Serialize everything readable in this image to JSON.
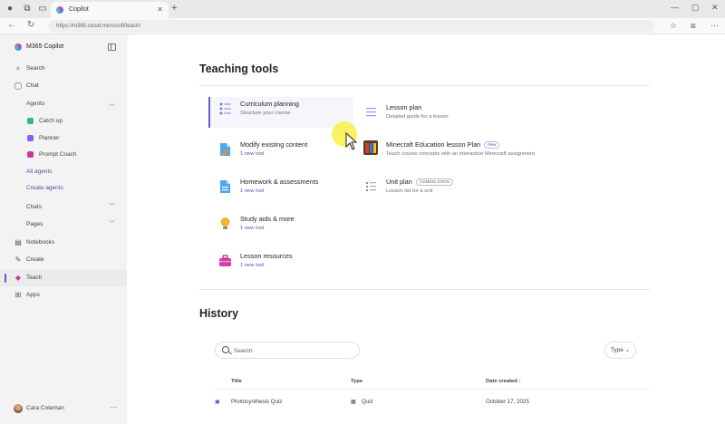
{
  "browser": {
    "tab_title": "Copilot",
    "url": "https://m365.cloud.microsoft/teach/"
  },
  "sidebar": {
    "brand": "M365 Copilot",
    "items": [
      {
        "label": "Search"
      },
      {
        "label": "Chat"
      },
      {
        "label": "Agents"
      },
      {
        "label": "Catch up"
      },
      {
        "label": "Planner"
      },
      {
        "label": "Prompt Coach"
      },
      {
        "label": "All agents"
      },
      {
        "label": "Create agents"
      },
      {
        "label": "Chats"
      },
      {
        "label": "Pages"
      },
      {
        "label": "Notebooks"
      },
      {
        "label": "Create"
      },
      {
        "label": "Teach"
      },
      {
        "label": "Apps"
      }
    ],
    "user": "Cara Coleman"
  },
  "main": {
    "section_title": "Teaching tools",
    "tools_left": [
      {
        "title": "Curriculum planning",
        "subtitle": "Structure your course"
      },
      {
        "title": "Modify existing content",
        "subtitle": "1 new tool"
      },
      {
        "title": "Homework & assessments",
        "subtitle": "1 new tool"
      },
      {
        "title": "Study aids & more",
        "subtitle": "1 new tool"
      },
      {
        "title": "Lesson resources",
        "subtitle": "1 new tool"
      }
    ],
    "tools_right": [
      {
        "title": "Lesson plan",
        "subtitle": "Detailed guide for a lesson"
      },
      {
        "title": "Minecraft Education lesson Plan",
        "badge": "New",
        "subtitle": "Teach course concepts with an interactive Minecraft assignment"
      },
      {
        "title": "Unit plan",
        "badge": "COMING SOON",
        "subtitle": "Lesson list for a unit"
      }
    ],
    "history_title": "History",
    "search_placeholder": "Search",
    "type_filter": "Type",
    "table": {
      "headers": [
        "Title",
        "Type",
        "Date created"
      ],
      "rows": [
        {
          "title": "Photosynthesis Quiz",
          "type": "Quiz",
          "date": "October 17, 2025"
        }
      ]
    }
  }
}
